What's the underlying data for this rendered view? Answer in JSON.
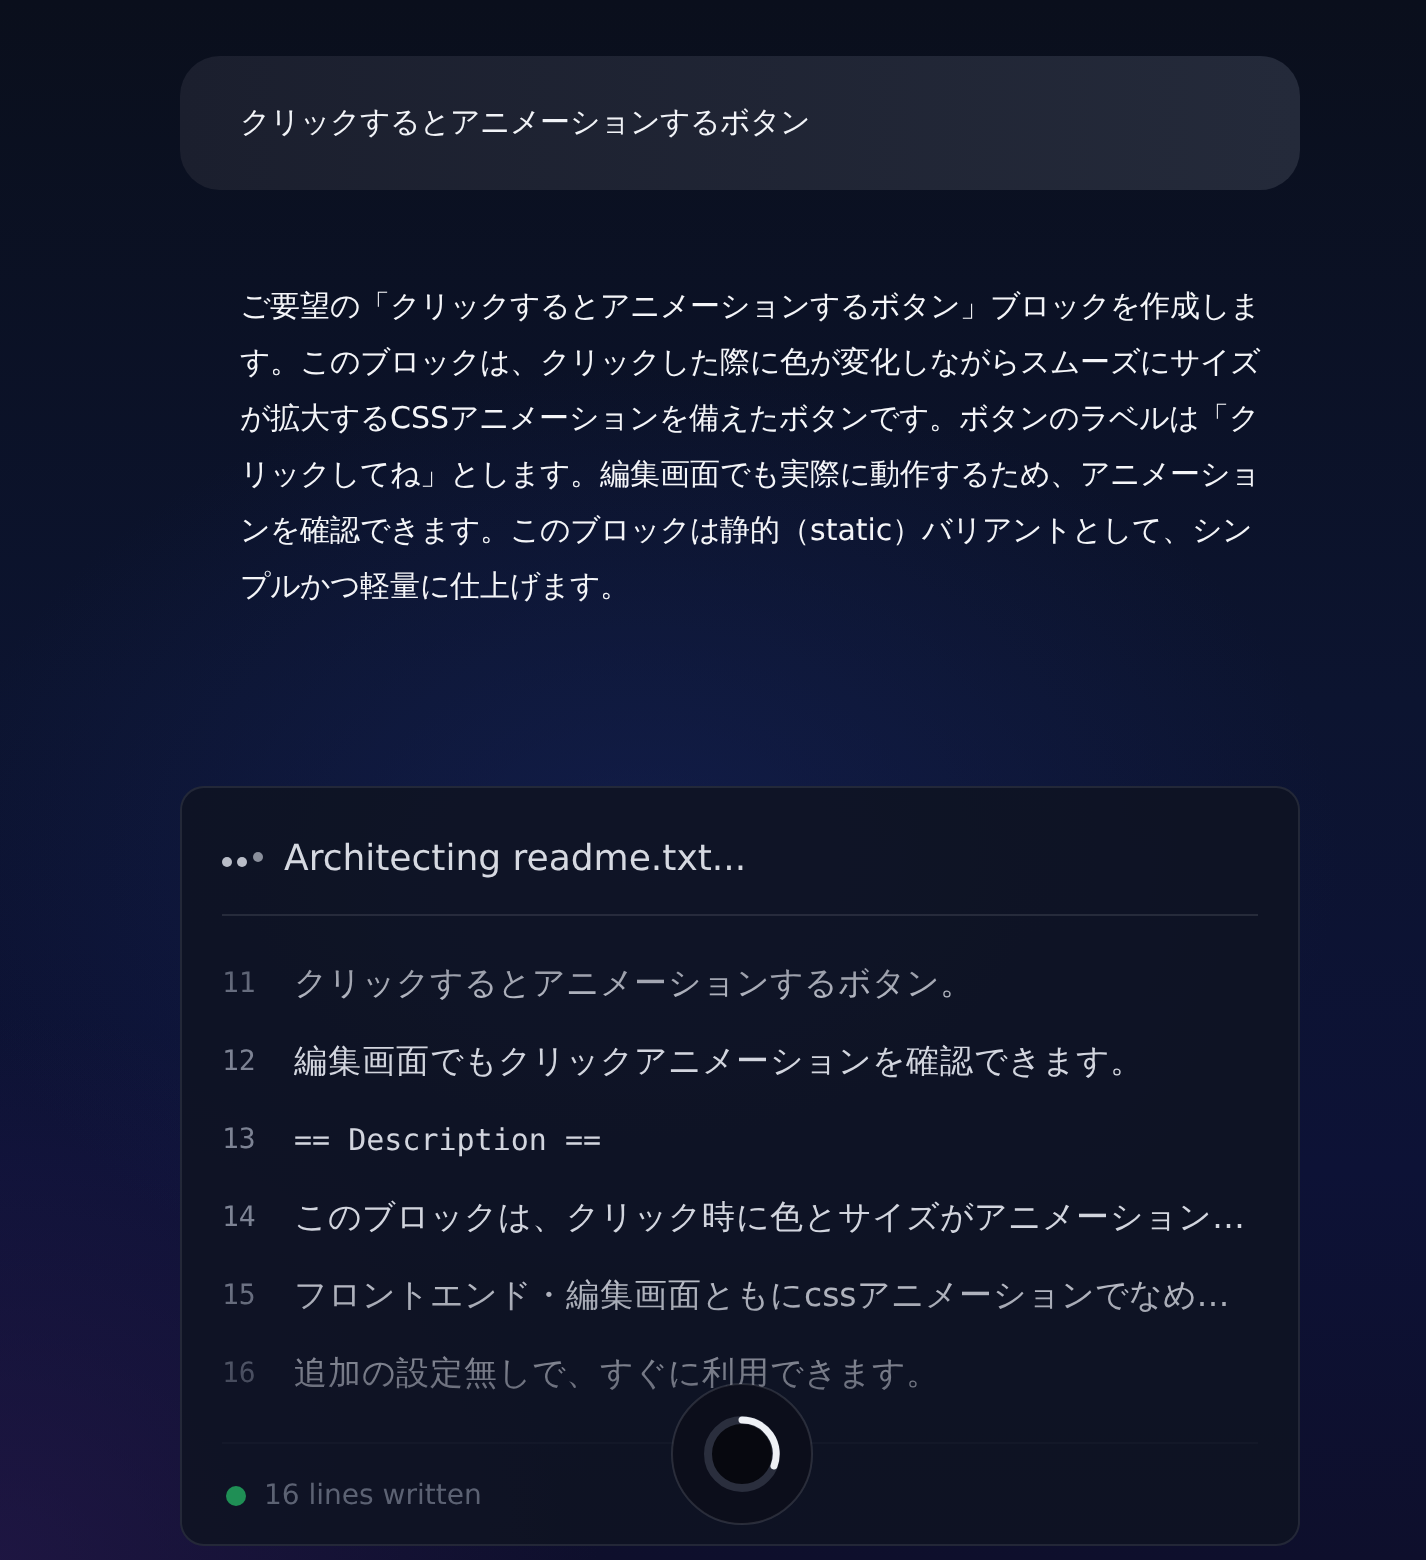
{
  "user_message": {
    "text": "クリックするとアニメーションするボタン"
  },
  "assistant_message": {
    "text": "ご要望の「クリックするとアニメーションするボタン」ブロックを作成します。このブロックは、クリックした際に色が変化しながらスムーズにサイズが拡大するCSSアニメーションを備えたボタンです。ボタンのラベルは「クリックしてね」とします。編集画面でも実際に動作するため、アニメーションを確認できます。このブロックは静的（static）バリアントとして、シンプルかつ軽量に仕上げます。"
  },
  "file_card": {
    "title": "Architecting readme.txt...",
    "lines": [
      {
        "number": "11",
        "kind": "text",
        "text": "クリックするとアニメーションするボタン。"
      },
      {
        "number": "12",
        "kind": "text",
        "text": "編集画面でもクリックアニメーションを確認できます。"
      },
      {
        "number": "13",
        "kind": "code",
        "text": "== Description =="
      },
      {
        "number": "14",
        "kind": "text",
        "text": "このブロックは、クリック時に色とサイズがアニメーション…"
      },
      {
        "number": "15",
        "kind": "text",
        "text": "フロントエンド・編集画面ともにcssアニメーションでなめ…"
      },
      {
        "number": "16",
        "kind": "text",
        "text": "追加の設定無しで、すぐに利用できます。"
      }
    ],
    "status": "16 lines written"
  }
}
